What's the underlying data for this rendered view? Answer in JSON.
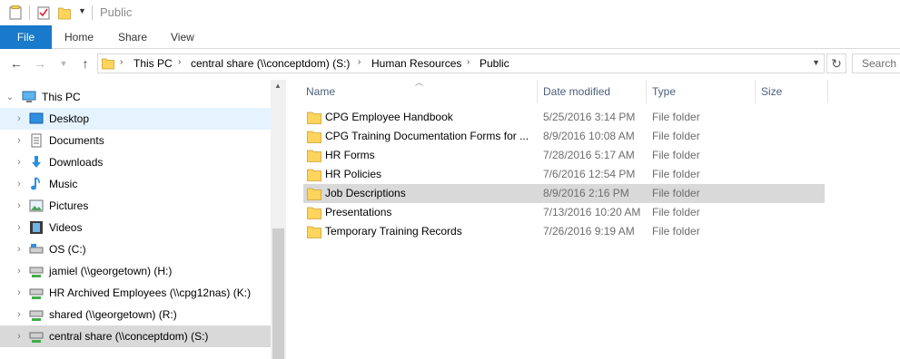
{
  "window": {
    "title": "Public"
  },
  "ribbon": {
    "file_label": "File",
    "tabs": [
      "Home",
      "Share",
      "View"
    ]
  },
  "address": {
    "crumbs": [
      "This PC",
      "central share (\\\\conceptdom) (S:)",
      "Human Resources",
      "Public"
    ],
    "search_placeholder": "Search P"
  },
  "nav": {
    "root_label": "This PC",
    "items": [
      {
        "label": "Desktop",
        "icon": "desktop-icon"
      },
      {
        "label": "Documents",
        "icon": "documents-icon"
      },
      {
        "label": "Downloads",
        "icon": "downloads-icon"
      },
      {
        "label": "Music",
        "icon": "music-icon"
      },
      {
        "label": "Pictures",
        "icon": "pictures-icon"
      },
      {
        "label": "Videos",
        "icon": "videos-icon"
      },
      {
        "label": "OS (C:)",
        "icon": "drive-icon"
      },
      {
        "label": "jamiel (\\\\georgetown) (H:)",
        "icon": "network-drive-icon"
      },
      {
        "label": "HR Archived Employees (\\\\cpg12nas) (K:)",
        "icon": "network-drive-icon"
      },
      {
        "label": "shared (\\\\georgetown) (R:)",
        "icon": "network-drive-icon"
      },
      {
        "label": "central share (\\\\conceptdom) (S:)",
        "icon": "network-drive-icon"
      }
    ]
  },
  "columns": {
    "name": "Name",
    "date": "Date modified",
    "type": "Type",
    "size": "Size"
  },
  "files": [
    {
      "name": "CPG Employee Handbook",
      "date": "5/25/2016 3:14 PM",
      "type": "File folder"
    },
    {
      "name": "CPG Training Documentation Forms for ...",
      "date": "8/9/2016 10:08 AM",
      "type": "File folder"
    },
    {
      "name": "HR Forms",
      "date": "7/28/2016 5:17 AM",
      "type": "File folder"
    },
    {
      "name": "HR Policies",
      "date": "7/6/2016 12:54 PM",
      "type": "File folder"
    },
    {
      "name": "Job Descriptions",
      "date": "8/9/2016 2:16 PM",
      "type": "File folder"
    },
    {
      "name": "Presentations",
      "date": "7/13/2016 10:20 AM",
      "type": "File folder"
    },
    {
      "name": "Temporary Training Records",
      "date": "7/26/2016 9:19 AM",
      "type": "File folder"
    }
  ],
  "colors": {
    "file_tab": "#1979ca",
    "selection": "#d9d9d9",
    "hover": "#e5f3ff",
    "folder": "#ffd45c"
  }
}
